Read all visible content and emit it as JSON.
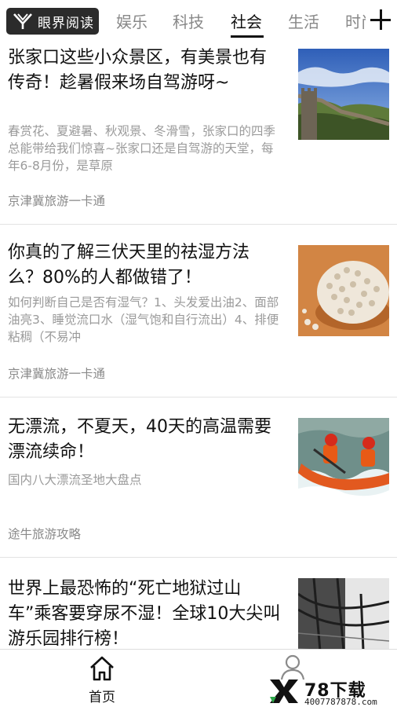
{
  "header": {
    "logo_text": "眼界阅读",
    "tabs": [
      {
        "label": "娱乐"
      },
      {
        "label": "科技"
      },
      {
        "label": "社会",
        "active": true
      },
      {
        "label": "生活"
      },
      {
        "label": "时尚"
      }
    ]
  },
  "articles": [
    {
      "title": "张家口这些小众景区，有美景也有传奇！趁暑假来场自驾游呀~",
      "summary": "春赏花、夏避暑、秋观景、冬滑雪，张家口的四季总能带给我们惊喜~张家口还是自驾游的天堂，每年6-8月份，是草原",
      "source": "京津冀旅游一卡通",
      "image_icon": "great-wall-photo"
    },
    {
      "title": "你真的了解三伏天里的祛湿方法么？80%的人都做错了！",
      "summary": "如何判断自己是否有湿气？1、头发爱出油2、面部油亮3、睡觉流口水（湿气饱和自行流出）4、排便粘稠（不易冲",
      "source": "京津冀旅游一卡通",
      "image_icon": "barley-bowl-photo"
    },
    {
      "title": "无漂流，不夏天，40天的高温需要漂流续命！",
      "summary": "国内八大漂流圣地大盘点",
      "source": "途牛旅游攻略",
      "image_icon": "rafting-photo"
    },
    {
      "title": "世界上最恐怖的“死亡地狱过山车”乘客要穿尿不湿！全球10大尖叫游乐园排行榜！",
      "summary": "",
      "source": "",
      "image_icon": "roller-coaster-photo"
    }
  ],
  "bottom_nav": {
    "home_label": "首页",
    "home_icon": "home-icon",
    "user_icon": "user-icon"
  },
  "watermark": {
    "title": "78下载",
    "subtitle": "4007787878.com"
  }
}
